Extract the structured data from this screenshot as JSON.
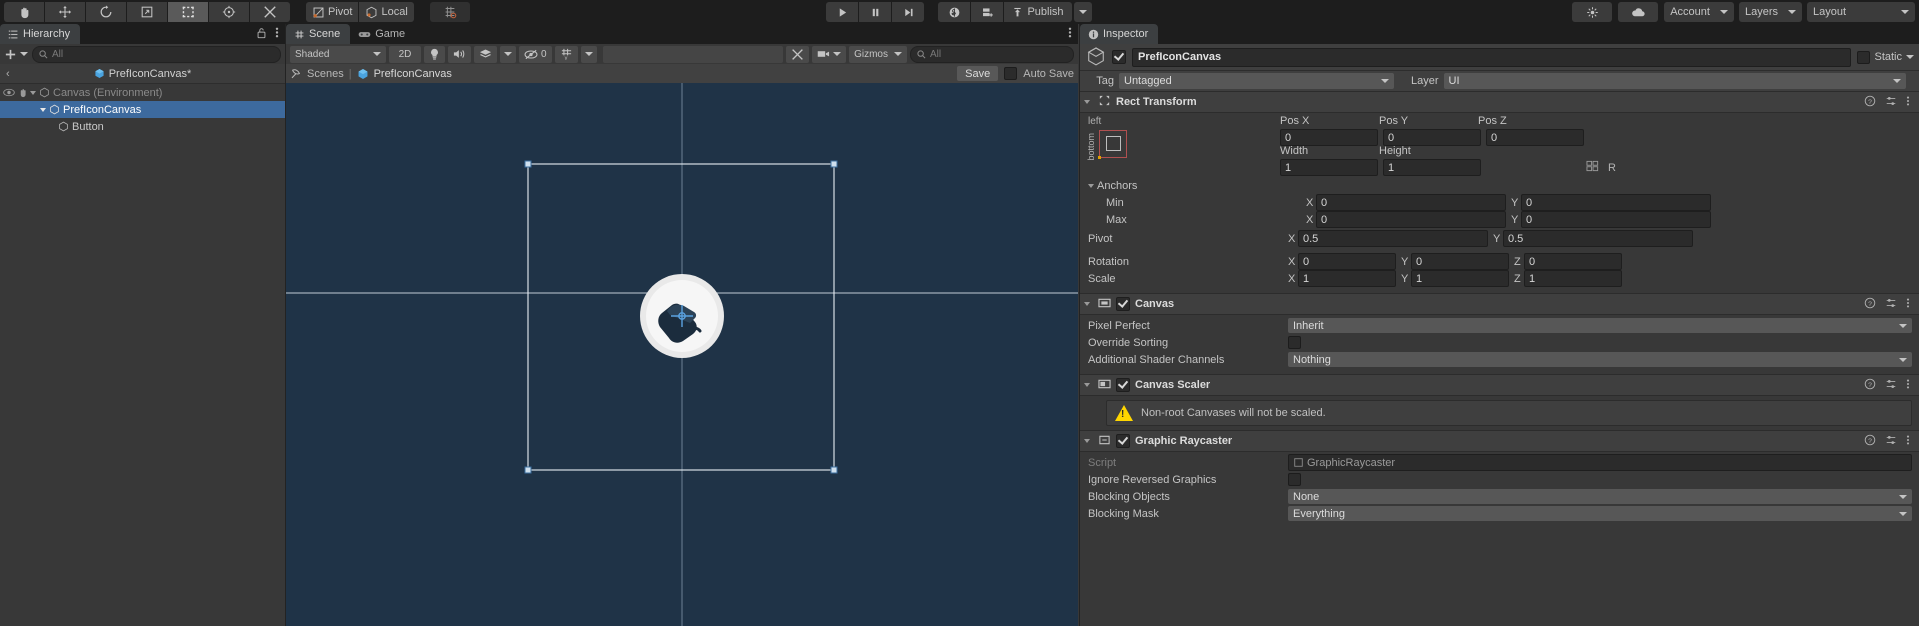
{
  "toolbar": {
    "tools": [
      {
        "name": "hand-tool",
        "icon": "hand",
        "active": false
      },
      {
        "name": "move-tool",
        "icon": "move",
        "active": false
      },
      {
        "name": "rotate-tool",
        "icon": "rotate",
        "active": false
      },
      {
        "name": "scale-tool",
        "icon": "scale",
        "active": false
      },
      {
        "name": "rect-tool",
        "icon": "rect",
        "active": true
      },
      {
        "name": "transform-tool",
        "icon": "transform",
        "active": false
      },
      {
        "name": "custom-tool",
        "icon": "wrench",
        "active": false
      }
    ],
    "pivot_label": "Pivot",
    "handle_label": "Local",
    "snap_icon": "grid-snap-icon",
    "play_label": "play",
    "pause_label": "pause",
    "step_label": "step",
    "collab_icon": "cloud-collab-icon",
    "services_icon": "services-icon",
    "publish_label": "Publish",
    "search_icon": "search-icon",
    "cloud_icon": "cloud-icon",
    "account_label": "Account",
    "layers_label": "Layers",
    "layout_label": "Layout"
  },
  "hierarchy": {
    "tab_label": "Hierarchy",
    "lock_icon": "lock-icon",
    "menu_icon": "kebab-menu-icon",
    "add_label": "+",
    "search_placeholder": "All",
    "breadcrumb_back": "‹",
    "breadcrumb_label": "PrefIconCanvas*",
    "rows": [
      {
        "label": "Canvas (Environment)",
        "depth": 1,
        "selected": false,
        "dim": true,
        "expandable": true,
        "eye": true
      },
      {
        "label": "PrefIconCanvas",
        "depth": 2,
        "selected": true,
        "dim": false,
        "expandable": true,
        "eye": false
      },
      {
        "label": "Button",
        "depth": 3,
        "selected": false,
        "dim": false,
        "expandable": false,
        "eye": false
      }
    ]
  },
  "scene": {
    "tabs": [
      {
        "label": "Scene",
        "selected": true,
        "icon": "grid-icon"
      },
      {
        "label": "Game",
        "selected": false,
        "icon": "gamepad-icon"
      }
    ],
    "menu_icon": "kebab-menu-icon",
    "shading_mode": "Shaded",
    "mode_2d": "2D",
    "light_icon": "light-icon",
    "audio_icon": "audio-icon",
    "fx_icon": "effects-icon",
    "hidden_count": "0",
    "grid_icon": "grid-visibility-icon",
    "tools_icon": "scene-tools-icon",
    "camera_icon": "camera-icon",
    "gizmos_label": "Gizmos",
    "gizmos_search_placeholder": "All",
    "breadcrumb": {
      "root": "Scenes",
      "separator": "|",
      "current": "PrefIconCanvas"
    },
    "save_label": "Save",
    "auto_save_label": "Auto Save",
    "auto_save_checked": false
  },
  "inspector": {
    "tab_label": "Inspector",
    "info_icon": "info-icon",
    "lock_icon": "lock-icon",
    "menu_icon": "kebab-menu-icon",
    "object_name": "PrefIconCanvas",
    "object_enabled": true,
    "static_label": "Static",
    "tag_label": "Tag",
    "tag_value": "Untagged",
    "layer_label": "Layer",
    "layer_value": "UI",
    "components": [
      {
        "name": "Rect Transform",
        "has_checkbox": false,
        "anchor_preset": {
          "top_label": "left",
          "side_label": "bottom"
        },
        "columns": [
          "Pos X",
          "Pos Y",
          "Pos Z"
        ],
        "pos": [
          "0",
          "0",
          "0"
        ],
        "size_columns": [
          "Width",
          "Height"
        ],
        "size": [
          "1",
          "1"
        ],
        "blueprint_icon": "blueprint-icon",
        "raw_icon": "R",
        "anchors_label": "Anchors",
        "min_label": "Min",
        "min": {
          "x": "0",
          "y": "0"
        },
        "max_label": "Max",
        "max": {
          "x": "0",
          "y": "0"
        },
        "pivot_label": "Pivot",
        "pivot": {
          "x": "0.5",
          "y": "0.5"
        },
        "rotation_label": "Rotation",
        "rotation": {
          "x": "0",
          "y": "0",
          "z": "0"
        },
        "scale_label": "Scale",
        "scale": {
          "x": "1",
          "y": "1",
          "z": "1"
        }
      },
      {
        "name": "Canvas",
        "has_checkbox": true,
        "enabled": true,
        "fields": [
          {
            "label": "Pixel Perfect",
            "type": "dropdown",
            "value": "Inherit"
          },
          {
            "label": "Override Sorting",
            "type": "checkbox",
            "value": false
          },
          {
            "label": "Additional Shader Channels",
            "type": "dropdown",
            "value": "Nothing"
          }
        ]
      },
      {
        "name": "Canvas Scaler",
        "has_checkbox": true,
        "enabled": true,
        "warning": "Non-root Canvases will not be scaled.",
        "fields": []
      },
      {
        "name": "Graphic Raycaster",
        "has_checkbox": true,
        "enabled": true,
        "script_label": "Script",
        "script_value": "GraphicRaycaster",
        "fields": [
          {
            "label": "Ignore Reversed Graphics",
            "type": "checkbox",
            "value": false
          },
          {
            "label": "Blocking Objects",
            "type": "dropdown",
            "value": "None"
          },
          {
            "label": "Blocking Mask",
            "type": "dropdown",
            "value": "Everything"
          }
        ]
      }
    ]
  },
  "colors": {
    "scene_bg": "#1f3347",
    "selection_blue": "#3d6a9e",
    "panel_bg": "#383838",
    "toolbar_bg": "#1d1d1d",
    "accent_orange": "#b05050",
    "warn_yellow": "#ffd600"
  }
}
